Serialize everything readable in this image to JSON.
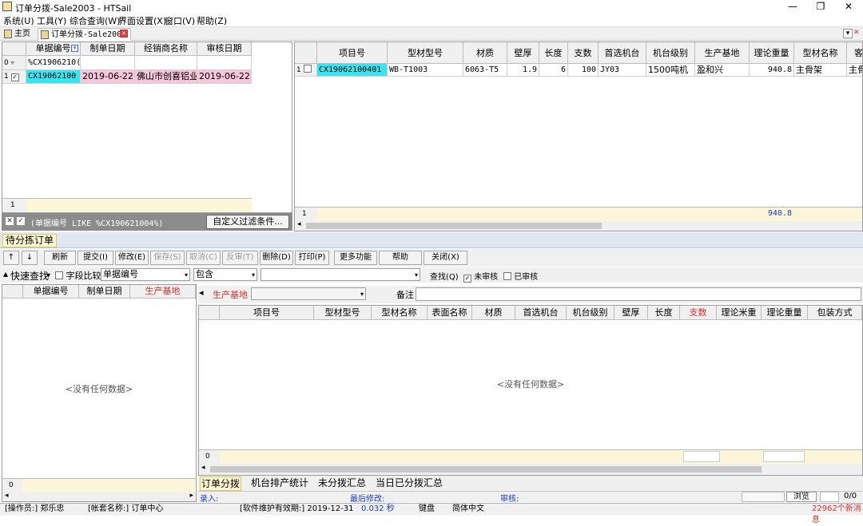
{
  "window": {
    "title": "订单分拨-Sale2003 - HTSail",
    "min": "—",
    "max": "❐",
    "close": "✕"
  },
  "menu": [
    "系统(U)",
    "工具(Y)",
    "综合查询(W)",
    "界面设置(X)",
    "窗口(V)",
    "帮助(Z)"
  ],
  "tabs": {
    "home": "主页",
    "current": "订单分拨-Sale2003",
    "close": "×",
    "dropdown": "▾"
  },
  "left_grid": {
    "headers": [
      "单据编号",
      "制单日期",
      "经销商名称",
      "审核日期"
    ],
    "filter_row": {
      "num": "0",
      "value": "%CX1906210("
    },
    "row": {
      "num": "1",
      "check": "✓",
      "doc_no": "CX19062100",
      "date": "2019-06-22",
      "dealer": "佛山市创喜铝业",
      "audit_date": "2019-06-22"
    },
    "footer_count": "1"
  },
  "filter_bar": {
    "text": "(单据编号 LIKE %CX190621004%)",
    "custom_btn": "自定义过滤条件..."
  },
  "right_grid": {
    "headers": [
      "项目号",
      "型材型号",
      "材质",
      "壁厚",
      "长度",
      "支数",
      "首选机台",
      "机台级别",
      "生产基地",
      "理论重量",
      "型材名称",
      "客"
    ],
    "row": {
      "num": "1",
      "item_no": "CX19062100401",
      "model": "WB-T1003",
      "material": "6063-T5",
      "thickness": "1.9",
      "length": "6",
      "count": "100",
      "machine": "JY03",
      "level": "1500吨机",
      "base": "盈和兴",
      "weight": "940.8",
      "name": "主骨架",
      "cust": "主骨"
    },
    "footer_count": "1",
    "footer_weight": "940.8"
  },
  "section_title": "待分拣订单",
  "toolbar": {
    "up": "↑",
    "down": "↓",
    "buttons": [
      "刷新",
      "提交(I)",
      "修改(E)",
      "保存(S)",
      "取消(C)",
      "反审(T)",
      "删除(D)",
      "打印(P)",
      "更多功能",
      "帮助",
      "关闭(X)"
    ]
  },
  "search": {
    "quick_label": "快速查找",
    "field_compare": "字段比较",
    "field": "单据编号",
    "op": "包含",
    "value": "",
    "find_btn": "查找(Q)",
    "unaudited": "未审核",
    "audited": "已审核"
  },
  "bottom_left_grid": {
    "headers": [
      "单据编号",
      "制单日期",
      "生产基地"
    ],
    "footer_count": "0"
  },
  "detail_form": {
    "base_label": "生产基地",
    "base_value": "",
    "note_label": "备注",
    "note_value": ""
  },
  "bottom_right_grid": {
    "headers": [
      "项目号",
      "型材型号",
      "型材名称",
      "表面名称",
      "材质",
      "首选机台",
      "机台级别",
      "壁厚",
      "长度",
      "支数",
      "理论米重",
      "理论重量",
      "包装方式"
    ],
    "empty_text": "<没有任何数据>",
    "footer_count": "0"
  },
  "empty_left": "<没有任何数据>",
  "bottom_tabs": [
    "订单分拨",
    "机台排产统计",
    "未分拨汇总",
    "当日已分拨汇总"
  ],
  "record_bar": {
    "entry": "录入:",
    "last_modified": "最后修改:",
    "audit": "审核:",
    "browse": "浏览",
    "pager": "0/0"
  },
  "statusbar": {
    "operator": "[操作员:]  郑乐忠",
    "account": "[帐套名称:]  订单中心",
    "maintenance": "[软件维护有效期:]   2019-12-31",
    "time": "0.032 秒",
    "keyboard": "键盘",
    "lang": "简体中文",
    "messages": "22962个新消息"
  },
  "colors": {
    "accent_blue": "#1a3fd0",
    "red": "#e0312b",
    "filter_bar_bg": "#8c8c8c",
    "selected_row": "#f7c6d8",
    "cell_cyan": "#35e6f0"
  }
}
